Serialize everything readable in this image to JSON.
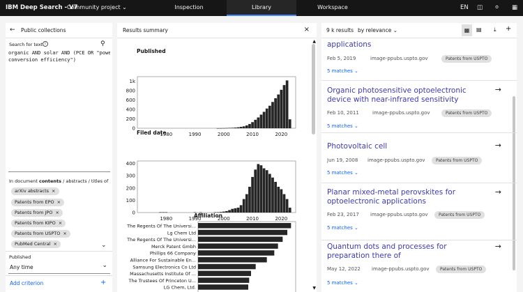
{
  "topbar": {
    "brand": "IBM Deep Search - V7",
    "project": "Community project",
    "tabs": [
      "Inspection",
      "Library",
      "Workspace"
    ],
    "lang": "EN"
  },
  "left": {
    "title": "Public collections",
    "search_label": "Search for text",
    "query": "organic AND solar AND (PCE OR \"power\nconversion efficiency\")",
    "in_document_prefix": "In document ",
    "in_document_bold": "contents",
    "in_document_rest": " / abstracts / titles of",
    "tags": [
      "arXiv abstracts",
      "Patents from EPO",
      "Patents from JPO",
      "Patents from KIPO",
      "Patents from USPTO",
      "PubMed Central"
    ],
    "published_label": "Published",
    "published_value": "Any time",
    "add_criterion": "Add criterion"
  },
  "middle": {
    "title": "Results summary",
    "published_label": "Published",
    "filed_label": "Filed date",
    "affiliation_label": "Affiliation"
  },
  "chart_data": [
    {
      "type": "bar",
      "title": "Published",
      "x": [
        1971,
        1972,
        1973,
        1974,
        1975,
        1976,
        1977,
        1978,
        1979,
        1980,
        1981,
        1982,
        1983,
        1984,
        1985,
        1986,
        1987,
        1988,
        1989,
        1990,
        1991,
        1992,
        1993,
        1994,
        1995,
        1996,
        1997,
        1998,
        1999,
        2000,
        2001,
        2002,
        2003,
        2004,
        2005,
        2006,
        2007,
        2008,
        2009,
        2010,
        2011,
        2012,
        2013,
        2014,
        2015,
        2016,
        2017,
        2018,
        2019,
        2020,
        2021,
        2022,
        2023
      ],
      "values": [
        0,
        0,
        0,
        0,
        0,
        0,
        0,
        0,
        0,
        0,
        0,
        0,
        0,
        0,
        0,
        0,
        0,
        0,
        0,
        0,
        0,
        0,
        0,
        0,
        0,
        0,
        0,
        1,
        2,
        3,
        5,
        8,
        10,
        14,
        20,
        30,
        40,
        60,
        90,
        130,
        180,
        230,
        290,
        350,
        420,
        480,
        560,
        640,
        720,
        820,
        920,
        1020,
        190
      ],
      "xticks": [
        "1980",
        "1990",
        "2000",
        "2010",
        "2020"
      ],
      "yticks": [
        "0",
        "200",
        "400",
        "600",
        "800",
        "1k"
      ],
      "ylim": [
        0,
        1100
      ]
    },
    {
      "type": "bar",
      "title": "Filed date",
      "x": [
        1976,
        1977,
        1978,
        1979,
        1980,
        1981,
        1982,
        1983,
        1984,
        1985,
        1986,
        1987,
        1988,
        1989,
        1990,
        1991,
        1992,
        1993,
        1994,
        1995,
        1996,
        1997,
        1998,
        1999,
        2000,
        2001,
        2002,
        2003,
        2004,
        2005,
        2006,
        2007,
        2008,
        2009,
        2010,
        2011,
        2012,
        2013,
        2014,
        2015,
        2016,
        2017,
        2018,
        2019,
        2020,
        2021,
        2022,
        2023
      ],
      "values": [
        0,
        0,
        3,
        3,
        3,
        0,
        0,
        0,
        0,
        0,
        0,
        0,
        0,
        0,
        3,
        0,
        3,
        0,
        0,
        0,
        0,
        3,
        3,
        5,
        8,
        12,
        20,
        30,
        35,
        40,
        60,
        110,
        150,
        210,
        290,
        350,
        395,
        385,
        360,
        345,
        315,
        285,
        250,
        210,
        190,
        150,
        110,
        40
      ],
      "xticks": [
        "1980",
        "1990",
        "2000",
        "2010",
        "2020"
      ],
      "yticks": [
        "0",
        "100",
        "200",
        "300",
        "400"
      ],
      "ylim": [
        0,
        420
      ]
    },
    {
      "type": "bar",
      "orientation": "horizontal",
      "title": "Affiliation",
      "categories": [
        "The Regents Of The Universi...",
        "Lg Chem Ltd",
        "The Regents Of The Universi...",
        "Merck Patent Gmbh",
        "Phillips 66 Company",
        "Alliance For Sustainable En...",
        "Samsung Electronics Co Ltd",
        "Massachusetts Institute Of ...",
        "The Trustees Of Princeton U...",
        "LG Chem, Ltd."
      ],
      "values": [
        100,
        96,
        91,
        86,
        82,
        74,
        62,
        57,
        55,
        54
      ],
      "xlim": [
        0,
        105
      ]
    }
  ],
  "right": {
    "count": "9 k results",
    "sort": "by relevance",
    "results": [
      {
        "title": "applications",
        "date": "Feb 5, 2019",
        "source": "image-ppubs.uspto.gov",
        "badge": "Patents from USPTO",
        "matches": "5 matches"
      },
      {
        "title": "Organic photosensitive optoelectronic device with near-infrared sensitivity",
        "date": "Feb 10, 2011",
        "source": "image-ppubs.uspto.gov",
        "badge": "Patents from USPTO",
        "matches": "5 matches"
      },
      {
        "title": "Photovoltaic cell",
        "date": "Jun 19, 2008",
        "source": "image-ppubs.uspto.gov",
        "badge": "Patents from USPTO",
        "matches": "5 matches"
      },
      {
        "title": "Planar mixed-metal perovskites for optoelectronic applications",
        "date": "Feb 23, 2017",
        "source": "image-ppubs.uspto.gov",
        "badge": "Patents from USPTO",
        "matches": "5 matches"
      },
      {
        "title": "Quantum dots and processes for preparation there of",
        "date": "May 12, 2022",
        "source": "image-ppubs.uspto.gov",
        "badge": "Patents from USPTO",
        "matches": "5 matches"
      }
    ]
  },
  "icons": {
    "back": "arrow-left-icon",
    "info": "info-icon",
    "search": "search-icon",
    "close": "close-icon",
    "grid": "grid-view-icon",
    "list": "list-view-icon",
    "download": "download-icon",
    "add": "add-icon",
    "chevron": "chevron-down-icon",
    "arrow": "arrow-right-icon",
    "book": "book-icon",
    "bell": "notification-icon",
    "user": "user-icon",
    "app": "app-switcher-icon"
  }
}
